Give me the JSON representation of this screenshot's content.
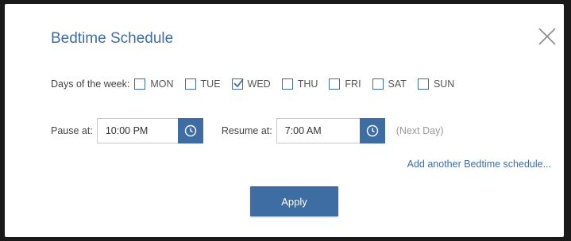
{
  "dialog": {
    "title": "Bedtime Schedule",
    "close_icon": "close-icon"
  },
  "days": {
    "label": "Days of the week:",
    "items": [
      {
        "label": "MON",
        "checked": false
      },
      {
        "label": "TUE",
        "checked": false
      },
      {
        "label": "WED",
        "checked": true
      },
      {
        "label": "THU",
        "checked": false
      },
      {
        "label": "FRI",
        "checked": false
      },
      {
        "label": "SAT",
        "checked": false
      },
      {
        "label": "SUN",
        "checked": false
      }
    ]
  },
  "pause": {
    "label": "Pause at:",
    "value": "10:00 PM",
    "icon": "clock-icon"
  },
  "resume": {
    "label": "Resume at:",
    "value": "7:00 AM",
    "icon": "clock-icon",
    "note": "(Next Day)"
  },
  "add_link": "Add another Bedtime schedule...",
  "apply_label": "Apply",
  "colors": {
    "accent": "#3e6da3",
    "muted_text": "#999999"
  }
}
